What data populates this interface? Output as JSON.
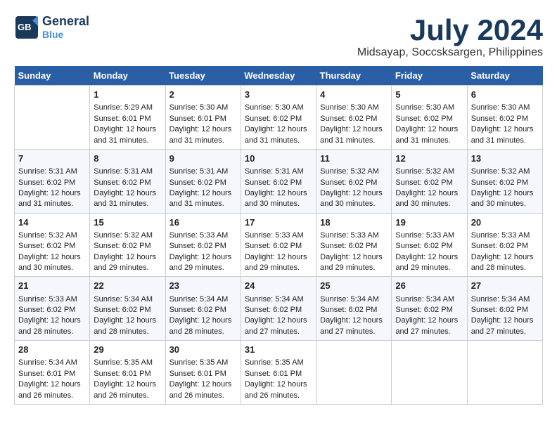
{
  "logo": {
    "general": "General",
    "blue": "Blue",
    "icon_alt": "GeneralBlue logo"
  },
  "title": {
    "month_year": "July 2024",
    "location": "Midsayap, Soccsksargen, Philippines"
  },
  "days_of_week": [
    "Sunday",
    "Monday",
    "Tuesday",
    "Wednesday",
    "Thursday",
    "Friday",
    "Saturday"
  ],
  "weeks": [
    [
      {
        "day": "",
        "info": ""
      },
      {
        "day": "1",
        "info": "Sunrise: 5:29 AM\nSunset: 6:01 PM\nDaylight: 12 hours\nand 31 minutes."
      },
      {
        "day": "2",
        "info": "Sunrise: 5:30 AM\nSunset: 6:01 PM\nDaylight: 12 hours\nand 31 minutes."
      },
      {
        "day": "3",
        "info": "Sunrise: 5:30 AM\nSunset: 6:02 PM\nDaylight: 12 hours\nand 31 minutes."
      },
      {
        "day": "4",
        "info": "Sunrise: 5:30 AM\nSunset: 6:02 PM\nDaylight: 12 hours\nand 31 minutes."
      },
      {
        "day": "5",
        "info": "Sunrise: 5:30 AM\nSunset: 6:02 PM\nDaylight: 12 hours\nand 31 minutes."
      },
      {
        "day": "6",
        "info": "Sunrise: 5:30 AM\nSunset: 6:02 PM\nDaylight: 12 hours\nand 31 minutes."
      }
    ],
    [
      {
        "day": "7",
        "info": "Sunrise: 5:31 AM\nSunset: 6:02 PM\nDaylight: 12 hours\nand 31 minutes."
      },
      {
        "day": "8",
        "info": "Sunrise: 5:31 AM\nSunset: 6:02 PM\nDaylight: 12 hours\nand 31 minutes."
      },
      {
        "day": "9",
        "info": "Sunrise: 5:31 AM\nSunset: 6:02 PM\nDaylight: 12 hours\nand 31 minutes."
      },
      {
        "day": "10",
        "info": "Sunrise: 5:31 AM\nSunset: 6:02 PM\nDaylight: 12 hours\nand 30 minutes."
      },
      {
        "day": "11",
        "info": "Sunrise: 5:32 AM\nSunset: 6:02 PM\nDaylight: 12 hours\nand 30 minutes."
      },
      {
        "day": "12",
        "info": "Sunrise: 5:32 AM\nSunset: 6:02 PM\nDaylight: 12 hours\nand 30 minutes."
      },
      {
        "day": "13",
        "info": "Sunrise: 5:32 AM\nSunset: 6:02 PM\nDaylight: 12 hours\nand 30 minutes."
      }
    ],
    [
      {
        "day": "14",
        "info": "Sunrise: 5:32 AM\nSunset: 6:02 PM\nDaylight: 12 hours\nand 30 minutes."
      },
      {
        "day": "15",
        "info": "Sunrise: 5:32 AM\nSunset: 6:02 PM\nDaylight: 12 hours\nand 29 minutes."
      },
      {
        "day": "16",
        "info": "Sunrise: 5:33 AM\nSunset: 6:02 PM\nDaylight: 12 hours\nand 29 minutes."
      },
      {
        "day": "17",
        "info": "Sunrise: 5:33 AM\nSunset: 6:02 PM\nDaylight: 12 hours\nand 29 minutes."
      },
      {
        "day": "18",
        "info": "Sunrise: 5:33 AM\nSunset: 6:02 PM\nDaylight: 12 hours\nand 29 minutes."
      },
      {
        "day": "19",
        "info": "Sunrise: 5:33 AM\nSunset: 6:02 PM\nDaylight: 12 hours\nand 29 minutes."
      },
      {
        "day": "20",
        "info": "Sunrise: 5:33 AM\nSunset: 6:02 PM\nDaylight: 12 hours\nand 28 minutes."
      }
    ],
    [
      {
        "day": "21",
        "info": "Sunrise: 5:33 AM\nSunset: 6:02 PM\nDaylight: 12 hours\nand 28 minutes."
      },
      {
        "day": "22",
        "info": "Sunrise: 5:34 AM\nSunset: 6:02 PM\nDaylight: 12 hours\nand 28 minutes."
      },
      {
        "day": "23",
        "info": "Sunrise: 5:34 AM\nSunset: 6:02 PM\nDaylight: 12 hours\nand 28 minutes."
      },
      {
        "day": "24",
        "info": "Sunrise: 5:34 AM\nSunset: 6:02 PM\nDaylight: 12 hours\nand 27 minutes."
      },
      {
        "day": "25",
        "info": "Sunrise: 5:34 AM\nSunset: 6:02 PM\nDaylight: 12 hours\nand 27 minutes."
      },
      {
        "day": "26",
        "info": "Sunrise: 5:34 AM\nSunset: 6:02 PM\nDaylight: 12 hours\nand 27 minutes."
      },
      {
        "day": "27",
        "info": "Sunrise: 5:34 AM\nSunset: 6:02 PM\nDaylight: 12 hours\nand 27 minutes."
      }
    ],
    [
      {
        "day": "28",
        "info": "Sunrise: 5:34 AM\nSunset: 6:01 PM\nDaylight: 12 hours\nand 26 minutes."
      },
      {
        "day": "29",
        "info": "Sunrise: 5:35 AM\nSunset: 6:01 PM\nDaylight: 12 hours\nand 26 minutes."
      },
      {
        "day": "30",
        "info": "Sunrise: 5:35 AM\nSunset: 6:01 PM\nDaylight: 12 hours\nand 26 minutes."
      },
      {
        "day": "31",
        "info": "Sunrise: 5:35 AM\nSunset: 6:01 PM\nDaylight: 12 hours\nand 26 minutes."
      },
      {
        "day": "",
        "info": ""
      },
      {
        "day": "",
        "info": ""
      },
      {
        "day": "",
        "info": ""
      }
    ]
  ]
}
